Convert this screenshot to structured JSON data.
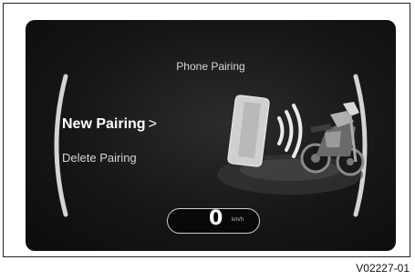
{
  "screen": {
    "title": "Phone Pairing",
    "menu": {
      "selected": {
        "label": "New Pairing",
        "chevron": ">"
      },
      "items": [
        {
          "label": "Delete Pairing"
        }
      ]
    },
    "speed": {
      "value": "0",
      "unit": "km/h"
    }
  },
  "figure": {
    "reference": "V02227-01"
  },
  "icons": [
    "phone-icon",
    "wireless-signal-icon",
    "motorcycle-icon",
    "left-gauge-arc",
    "right-gauge-arc"
  ],
  "colors": {
    "screen_bg": "#141414",
    "text_primary": "#ffffff",
    "text_secondary": "#d6d6d6"
  }
}
